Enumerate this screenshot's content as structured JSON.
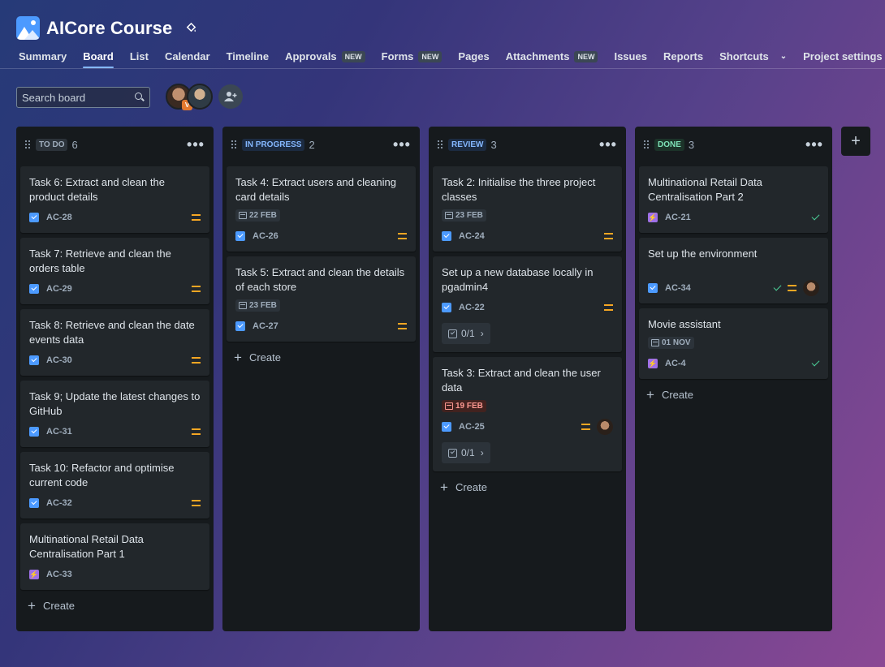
{
  "project": {
    "title": "AICore Course",
    "icon": "project-mountain-icon"
  },
  "tabs": [
    {
      "label": "Summary",
      "badge": ""
    },
    {
      "label": "Board",
      "badge": "",
      "active": true
    },
    {
      "label": "List",
      "badge": ""
    },
    {
      "label": "Calendar",
      "badge": ""
    },
    {
      "label": "Timeline",
      "badge": ""
    },
    {
      "label": "Approvals",
      "badge": "NEW"
    },
    {
      "label": "Forms",
      "badge": "NEW"
    },
    {
      "label": "Pages",
      "badge": ""
    },
    {
      "label": "Attachments",
      "badge": "NEW"
    },
    {
      "label": "Issues",
      "badge": ""
    },
    {
      "label": "Reports",
      "badge": ""
    },
    {
      "label": "Shortcuts",
      "badge": ""
    },
    {
      "label": "Project settings",
      "badge": ""
    }
  ],
  "search": {
    "placeholder": "Search board"
  },
  "avatar_badge": "V",
  "create_label": "Create",
  "columns": [
    {
      "status": "TO DO",
      "count": "6",
      "style": "todo",
      "cards": [
        {
          "title": "Task 6: Extract and clean the product details",
          "key": "AC-28",
          "type": "task",
          "priority": true
        },
        {
          "title": "Task 7: Retrieve and clean the orders table",
          "key": "AC-29",
          "type": "task",
          "priority": true
        },
        {
          "title": "Task 8: Retrieve and clean the date events data",
          "key": "AC-30",
          "type": "task",
          "priority": true
        },
        {
          "title": "Task 9; Update the latest changes to GitHub",
          "key": "AC-31",
          "type": "task",
          "priority": true
        },
        {
          "title": "Task 10: Refactor and optimise current code",
          "key": "AC-32",
          "type": "task",
          "priority": true
        },
        {
          "title": "Multinational Retail Data Centralisation Part 1",
          "key": "AC-33",
          "type": "epic"
        }
      ]
    },
    {
      "status": "IN PROGRESS",
      "count": "2",
      "style": "prog",
      "cards": [
        {
          "title": "Task 4: Extract users and cleaning card details",
          "date": "22 FEB",
          "key": "AC-26",
          "type": "task",
          "priority": true
        },
        {
          "title": "Task 5: Extract and clean the details of each store",
          "date": "23 FEB",
          "key": "AC-27",
          "type": "task",
          "priority": true
        }
      ]
    },
    {
      "status": "REVIEW",
      "count": "3",
      "style": "review",
      "cards": [
        {
          "title": "Task 2: Initialise the three project classes",
          "date": "23 FEB",
          "key": "AC-24",
          "type": "task",
          "priority": true
        },
        {
          "title": "Set up a new database locally in pgadmin4",
          "key": "AC-22",
          "type": "task",
          "priority": true,
          "subtasks": "0/1"
        },
        {
          "title": "Task 3: Extract and clean the user data",
          "date": "19 FEB",
          "overdue": true,
          "key": "AC-25",
          "type": "task",
          "priority": true,
          "assignee": true,
          "subtasks": "0/1"
        }
      ]
    },
    {
      "status": "DONE",
      "count": "3",
      "style": "done",
      "cards": [
        {
          "title": "Multinational Retail Data Centralisation Part 2",
          "key": "AC-21",
          "type": "epic",
          "done": true
        },
        {
          "title": "Set up the environment",
          "key": "AC-34",
          "type": "task",
          "done": true,
          "priority": true,
          "assignee": true,
          "gap": true
        },
        {
          "title": "Movie assistant",
          "date": "01 NOV",
          "key": "AC-4",
          "type": "epic",
          "done": true
        }
      ]
    }
  ]
}
